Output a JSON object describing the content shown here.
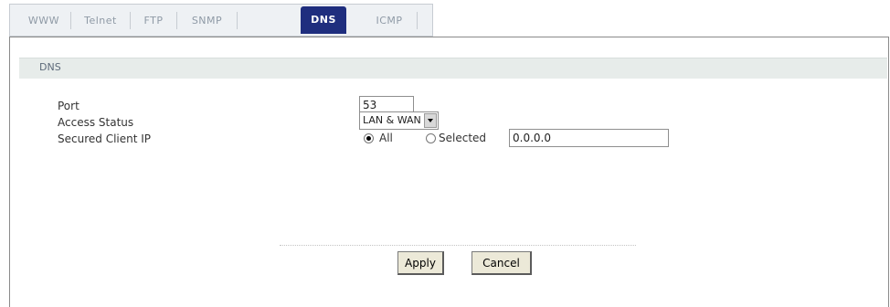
{
  "tabs": [
    {
      "label": "WWW",
      "active": false
    },
    {
      "label": "Telnet",
      "active": false
    },
    {
      "label": "FTP",
      "active": false
    },
    {
      "label": "SNMP",
      "active": false
    },
    {
      "label": "DNS",
      "active": true
    },
    {
      "label": "ICMP",
      "active": false
    }
  ],
  "section": {
    "title": "DNS"
  },
  "form": {
    "port_label": "Port",
    "port_value": "53",
    "access_status_label": "Access Status",
    "access_status_value": "LAN & WAN",
    "secured_client_ip_label": "Secured Client IP",
    "radio_all_label": "All",
    "radio_selected_label": "Selected",
    "selected_radio": "All",
    "ip_value": "0.0.0.0"
  },
  "buttons": {
    "apply": "Apply",
    "cancel": "Cancel"
  },
  "colors": {
    "active_tab": "#1f2e7e",
    "section_bar": "#e7ecea"
  }
}
